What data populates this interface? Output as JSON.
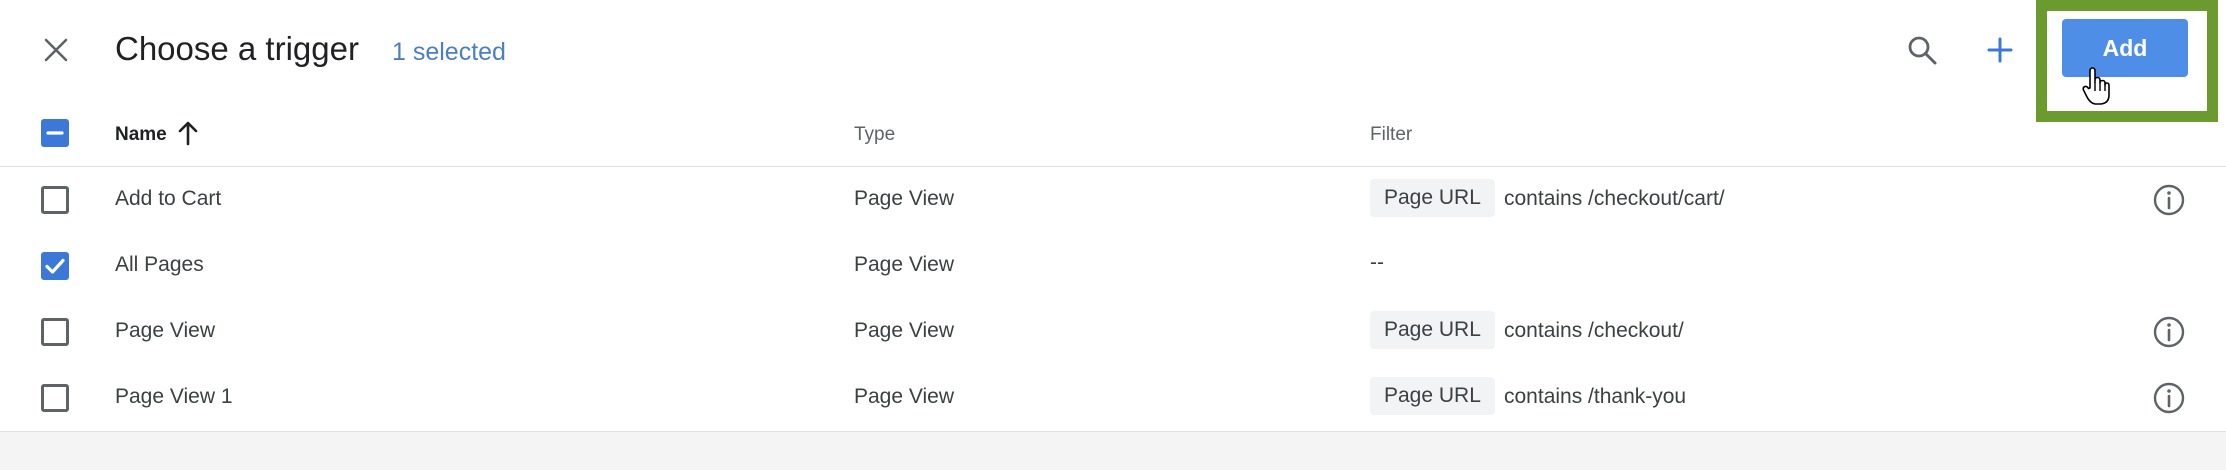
{
  "header": {
    "title": "Choose a trigger",
    "selected_count": "1 selected",
    "add_label": "Add"
  },
  "columns": {
    "name": "Name",
    "type": "Type",
    "filter": "Filter"
  },
  "rows": [
    {
      "name": "Add to Cart",
      "type": "Page View",
      "checked": false,
      "filter_var": "Page URL",
      "filter_text": "contains /checkout/cart/",
      "has_info": true
    },
    {
      "name": "All Pages",
      "type": "Page View",
      "checked": true,
      "filter_dash": "--",
      "has_info": false
    },
    {
      "name": "Page View",
      "type": "Page View",
      "checked": false,
      "filter_var": "Page URL",
      "filter_text": "contains /checkout/",
      "has_info": true
    },
    {
      "name": "Page View 1",
      "type": "Page View",
      "checked": false,
      "filter_var": "Page URL",
      "filter_text": "contains /thank-you",
      "has_info": true
    }
  ],
  "colors": {
    "accent": "#4f8ee6",
    "checkbox": "#3b78d8",
    "selected_text": "#4a7fc4",
    "highlight_border": "#6b9a2e"
  },
  "icons": {
    "close": "close-icon",
    "search": "search-icon",
    "plus": "plus-icon",
    "sort": "arrow-up-icon",
    "info": "info-icon",
    "cursor": "hand-pointer-icon"
  }
}
